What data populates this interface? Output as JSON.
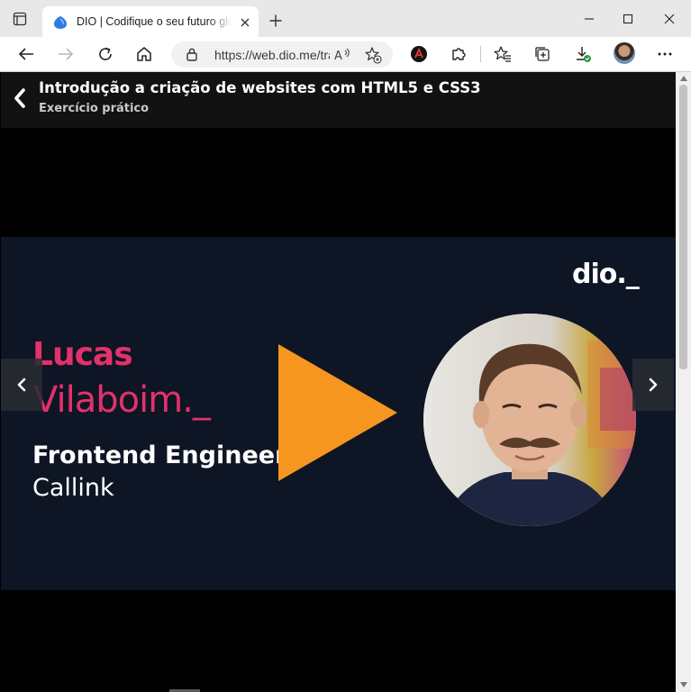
{
  "browser": {
    "tab_title": "DIO | Codifique o seu futuro global",
    "url": "https://web.dio.me/track/coding-the-future-inter-full-stack-developer",
    "read_aloud_label": "A",
    "colors": {
      "tabstrip": "#e8e8e8",
      "toolbar": "#ffffff",
      "edge_blue": "#2f7ae5",
      "download_badge": "#2e9b4a"
    }
  },
  "lesson": {
    "title": "Introdução a criação de websites com HTML5 e CSS3",
    "subtitle": "Exercício prático"
  },
  "video": {
    "logo": "dio._",
    "instructor_first": "Lucas",
    "instructor_last": "Vilaboim._",
    "role": "Frontend Engineer",
    "company": "Callink",
    "colors": {
      "panel": "#0e1524",
      "accent_pink": "#e2316b",
      "play_orange": "#f7961e"
    }
  },
  "icons": {
    "window_menu": "window-menu-icon",
    "favicon": "dio-favicon-icon",
    "close": "close-icon",
    "new_tab": "plus-icon",
    "minimize": "minimize-icon",
    "maximize": "maximize-icon",
    "window_close": "window-close-icon",
    "back": "arrow-left-icon",
    "forward": "arrow-right-icon",
    "refresh": "refresh-icon",
    "home": "home-icon",
    "lock": "lock-icon",
    "favorite_add": "star-plus-icon",
    "extension_red": "extension-red-icon",
    "extensions": "puzzle-icon",
    "favorites": "favorites-icon",
    "collections": "collections-icon",
    "downloads": "download-icon",
    "more": "more-dots-icon",
    "play": "play-icon",
    "prev": "chevron-left-icon",
    "next": "chevron-right-icon"
  }
}
